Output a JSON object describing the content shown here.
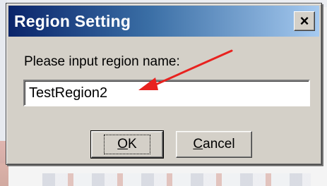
{
  "dialog": {
    "title": "Region Setting",
    "close_glyph": "×",
    "close_icon": "close-icon",
    "prompt": "Please input region name:",
    "input_value": "TestRegion2",
    "annotation_color": "#e8221f",
    "ok": {
      "mnemonic": "O",
      "rest": "K"
    },
    "cancel": {
      "mnemonic": "C",
      "rest": "ancel"
    }
  }
}
